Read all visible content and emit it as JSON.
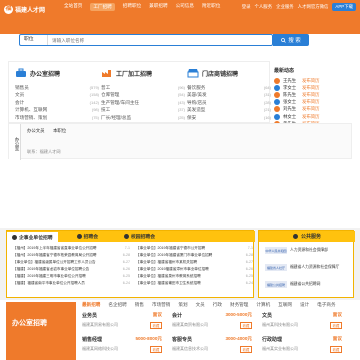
{
  "header": {
    "logo_text": "福建人才网",
    "nav": [
      "全站首页",
      "工厂招聘",
      "招聘职位",
      "兼职招聘",
      "公司信息",
      "附近职位"
    ],
    "active_nav": 1,
    "links": [
      "登录",
      "个人服务",
      "企业服务",
      "人才网官方微信",
      "APP下载"
    ]
  },
  "search": {
    "type_label": "职位",
    "placeholder": "请输入职位名称",
    "button_label": "搜 索"
  },
  "hot_links": [
    "热门职位：",
    "销售",
    "普工",
    "文员",
    "会计",
    "客服",
    "司机",
    "设计",
    "行政",
    "技工",
    "其他"
  ],
  "categories": [
    {
      "title": "办公室招聘",
      "color": "#2a7fd6",
      "rows": [
        [
          "销售员",
          "(579)"
        ],
        [
          "文员",
          "(158)"
        ],
        [
          "会计",
          "(142)"
        ],
        [
          "计算机、互联网",
          "(98)"
        ],
        [
          "市场营销、策划",
          "(75)"
        ]
      ]
    },
    {
      "title": "工厂加工招聘",
      "color": "#ef7a2b",
      "rows": [
        [
          "普工",
          "(96)"
        ],
        [
          "仓库管理",
          "(54)"
        ],
        [
          "生产管理/车间主任",
          "(43)"
        ],
        [
          "技工",
          "(37)"
        ],
        [
          "厂长/经理/总监",
          "(25)"
        ]
      ]
    },
    {
      "title": "门店商铺招聘",
      "color": "#2a7fd6",
      "rows": [
        [
          "餐饮服务",
          "(64)"
        ],
        [
          "美容/美发",
          "(31)"
        ],
        [
          "导购/店员",
          "(28)"
        ],
        [
          "美发造型",
          "(21)"
        ],
        [
          "保安",
          "(16)"
        ]
      ]
    }
  ],
  "latest": {
    "title": "最新动态",
    "rows": [
      {
        "name": "王先生",
        "text": "发布简历",
        "color": "#ef7a2b"
      },
      {
        "name": "李女士",
        "text": "发布简历",
        "color": "#2a7fd6"
      },
      {
        "name": "陈先生",
        "text": "发布简历",
        "color": "#ef7a2b"
      },
      {
        "name": "张女士",
        "text": "发布简历",
        "color": "#2a7fd6"
      },
      {
        "name": "刘先生",
        "text": "发布简历",
        "color": "#ef7a2b"
      },
      {
        "name": "林女士",
        "text": "发布简历",
        "color": "#2a7fd6"
      },
      {
        "name": "黄先生",
        "text": "发布简历",
        "color": "#ef7a2b"
      }
    ]
  },
  "profile": {
    "tag": "办公室",
    "sub_left": "办公文员",
    "sub_right": "本职位",
    "line": "联系：福建人才网"
  },
  "news": {
    "tabs": [
      "企事业单位招聘",
      "招聘会",
      "校园招聘会"
    ],
    "active_tab": 0,
    "lines": [
      [
        "【福州】2019年上半年福建省省直事业单位公开招聘",
        "7-1"
      ],
      [
        "【事业单位】2019年福建省宁德市公开招聘",
        "7-1"
      ],
      [
        "【福州】2019年福建省宁德市柘荣县教育局公开招聘",
        "6-28"
      ],
      [
        "【事业单位】2019年福建省厦门市事业单位招聘",
        "6-28"
      ],
      [
        "【事业单位】福建省级属单位公开招聘工作人员公告",
        "6-27"
      ],
      [
        "【事业单位】福建省福州市某机关招聘",
        "6-27"
      ],
      [
        "【福建】2019年福建省龙岩市事业单位招聘公告",
        "6-26"
      ],
      [
        "【事业单位】2019福建省漳州市事业单位招聘",
        "6-26"
      ],
      [
        "【福建】2019年福建三明市事业单位公开招聘",
        "6-25"
      ],
      [
        "【事业单位】福建省泉州市教育系统招聘",
        "6-25"
      ],
      [
        "【福建】福建省南平市事业单位公开招聘人员",
        "6-24"
      ],
      [
        "【事业单位】福建省莆田市卫生系统招聘",
        "6-24"
      ]
    ]
  },
  "public_service": {
    "title": "公共服务",
    "items": [
      {
        "logo": "中华人民共和国",
        "text": "人力资源和社会保障部"
      },
      {
        "logo": "福建省人社厅",
        "text": "福建省人力资源和社会保障厅"
      },
      {
        "logo": "福建公共招聘",
        "text": "福建省公共招聘网"
      }
    ]
  },
  "office": {
    "banner_title": "办公室招聘",
    "tabs": [
      "最新招聘",
      "名企招聘",
      "销售",
      "市场营销",
      "策划",
      "文员",
      "行政",
      "财务管理",
      "计算机",
      "互联网",
      "设计",
      "电子商务"
    ],
    "active_tab": 0,
    "jobs": [
      {
        "title": "业务员",
        "pay": "面议",
        "company": "福建某贸易有限公司",
        "fav": "收藏"
      },
      {
        "title": "会计",
        "pay": "3000-5000元",
        "company": "福建某商贸有限公司",
        "fav": "收藏"
      },
      {
        "title": "文员",
        "pay": "面议",
        "company": "福州某科技有限公司",
        "fav": "收藏"
      },
      {
        "title": "销售经理",
        "pay": "5000-8000元",
        "company": "福建某网络科技公司",
        "fav": "收藏"
      },
      {
        "title": "客服专员",
        "pay": "3000-4000元",
        "company": "福建某信息技术公司",
        "fav": "收藏"
      },
      {
        "title": "行政助理",
        "pay": "面议",
        "company": "福州某实业有限公司",
        "fav": "收藏"
      }
    ]
  }
}
